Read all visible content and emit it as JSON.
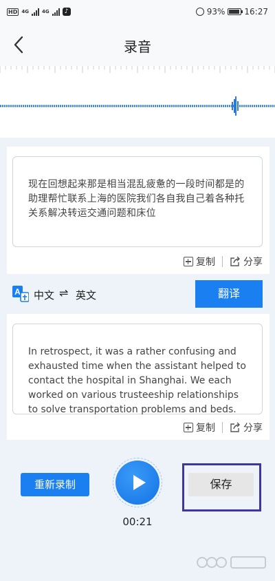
{
  "status_bar": {
    "hd_badge": "HD",
    "network_1": "4G",
    "network_2": "4G",
    "battery_percent": "93%",
    "time": "16:27"
  },
  "header": {
    "title": "录音"
  },
  "recognized_text": "现在回想起来那是相当混乱疲惫的一段时间都是的助理帮忙联系上海的医院我们各自我自己着各种托关系解决转运交通问题和床位",
  "translation_text": "In retrospect, it was a rather confusing and exhausted time when the assistant helped to contact the hospital in Shanghai. We each worked on various trusteeship relationships to solve transportation problems and beds.",
  "actions": {
    "copy_label": "复制",
    "share_label": "分享"
  },
  "translate_row": {
    "source_lang": "中文",
    "target_lang": "英文",
    "translate_label": "翻译"
  },
  "controls": {
    "rerecord_label": "重新录制",
    "timer": "00:21",
    "save_label": "保存"
  },
  "colors": {
    "accent": "#1a7ff0",
    "save_highlight": "#3b35a6",
    "background": "#eef3f9"
  }
}
